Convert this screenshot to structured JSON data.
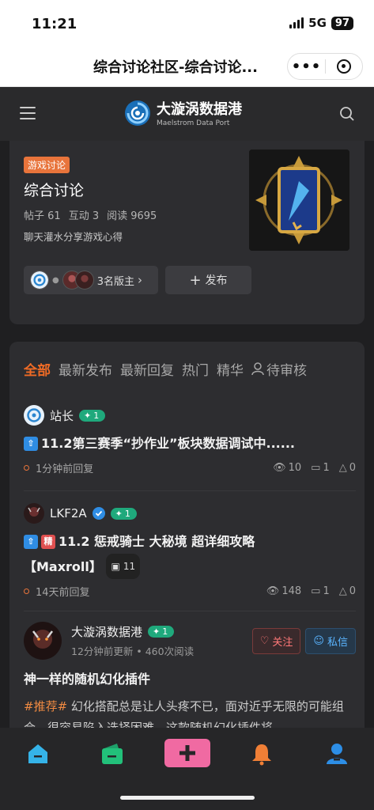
{
  "status": {
    "time": "11:21",
    "network": "5G",
    "battery": "97"
  },
  "titlebar": {
    "title": "综合讨论社区-综合讨论...",
    "more": "•••"
  },
  "header": {
    "logo_cn": "大漩涡数据港",
    "logo_en": "Maelstrom Data Port"
  },
  "board": {
    "tag": "游戏讨论",
    "name": "综合讨论",
    "posts": "帖子 61",
    "interactions": "互动 3",
    "reads": "阅读 9695",
    "desc": "聊天灌水分享游戏心得",
    "moderators": "3名版主",
    "publish": "发布"
  },
  "tabs": [
    "全部",
    "最新发布",
    "最新回复",
    "热门",
    "精华",
    "待审核"
  ],
  "posts": [
    {
      "user": "站长",
      "level": "1",
      "title": "11.2第三赛季“抄作业”板块数据调试中......",
      "time": "1分钟前回复",
      "views": "10",
      "comments": "1",
      "likes": "0"
    },
    {
      "user": "LKF2A",
      "level": "1",
      "title1": "11.2 惩戒骑士 大秘境 超详细攻略",
      "title2": "【Maxroll】",
      "images": "11",
      "time": "14天前回复",
      "views": "148",
      "comments": "1",
      "likes": "0"
    },
    {
      "user": "大漩涡数据港",
      "level": "1",
      "sub": "12分钟前更新 • 460次阅读",
      "follow": "关注",
      "pm": "私信",
      "title": "神一样的随机幻化插件",
      "tag": "#推荐#",
      "body": " 幻化搭配总是让人头疼不已，面对近乎无限的可能组合，很容易陷入选择困难。这款随机幻化插件将"
    }
  ],
  "colors": {
    "accent": "#f06b25",
    "level": "#1fa97c",
    "bg": "#1f1f21",
    "card": "#2d2d30"
  }
}
